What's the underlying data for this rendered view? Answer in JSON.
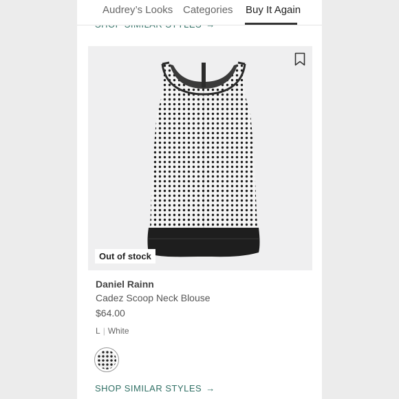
{
  "tabs": [
    {
      "label": "Audrey’s Looks",
      "active": false
    },
    {
      "label": "Categories",
      "active": false
    },
    {
      "label": "Buy It Again",
      "active": true
    }
  ],
  "top_link": {
    "label": "SHOP SIMILAR STYLES",
    "arrow": "→"
  },
  "product": {
    "badge": "Out of stock",
    "brand": "Daniel Rainn",
    "name": "Cadez Scoop Neck Blouse",
    "price": "$64.00",
    "size": "L",
    "separator": "|",
    "color": "White",
    "swatch_icon": "polka-dot-swatch",
    "bookmark_icon": "bookmark-icon"
  },
  "shop_link": {
    "label": "SHOP SIMILAR STYLES",
    "arrow": "→"
  },
  "colors": {
    "accent": "#2f6f64",
    "image_bg": "#efeff0",
    "text_dark": "#222222",
    "text_muted": "#666666"
  }
}
